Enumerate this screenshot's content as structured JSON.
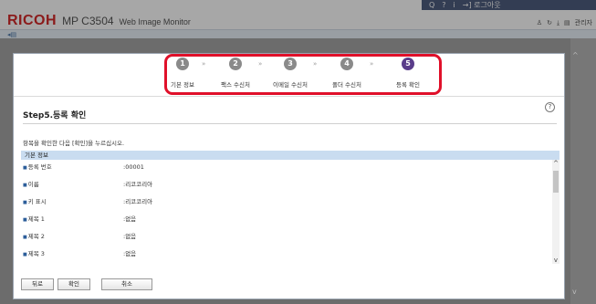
{
  "header": {
    "brand": "RICOH",
    "model": "MP C3504",
    "app": "Web Image Monitor",
    "topbar_items": [
      "Q",
      "?",
      "i",
      "→] 로그아웃"
    ],
    "right_label": "관리자"
  },
  "dialog": {
    "steps": [
      {
        "num": "1",
        "label": "기본 정보"
      },
      {
        "num": "2",
        "label": "팩스 수신처"
      },
      {
        "num": "3",
        "label": "이메일 수신처"
      },
      {
        "num": "4",
        "label": "폴더 수신처"
      },
      {
        "num": "5",
        "label": "등록 확인"
      }
    ],
    "title": "Step5.등록 확인",
    "help_icon": "?",
    "instruction": "항목을 확인한 다음 [확인]을 누르십시오.",
    "section_header": "기본 정보",
    "rows": [
      {
        "label": "등록 번호",
        "value": ":00001"
      },
      {
        "label": "이름",
        "value": ":리코코리아"
      },
      {
        "label": "키 표시",
        "value": ":리코코리아"
      },
      {
        "label": "제목 1",
        "value": ":없음"
      },
      {
        "label": "제목 2",
        "value": ":없음"
      },
      {
        "label": "제목 3",
        "value": ":없음"
      }
    ],
    "buttons": {
      "back": "뒤로",
      "ok": "확인",
      "cancel": "취소"
    }
  }
}
